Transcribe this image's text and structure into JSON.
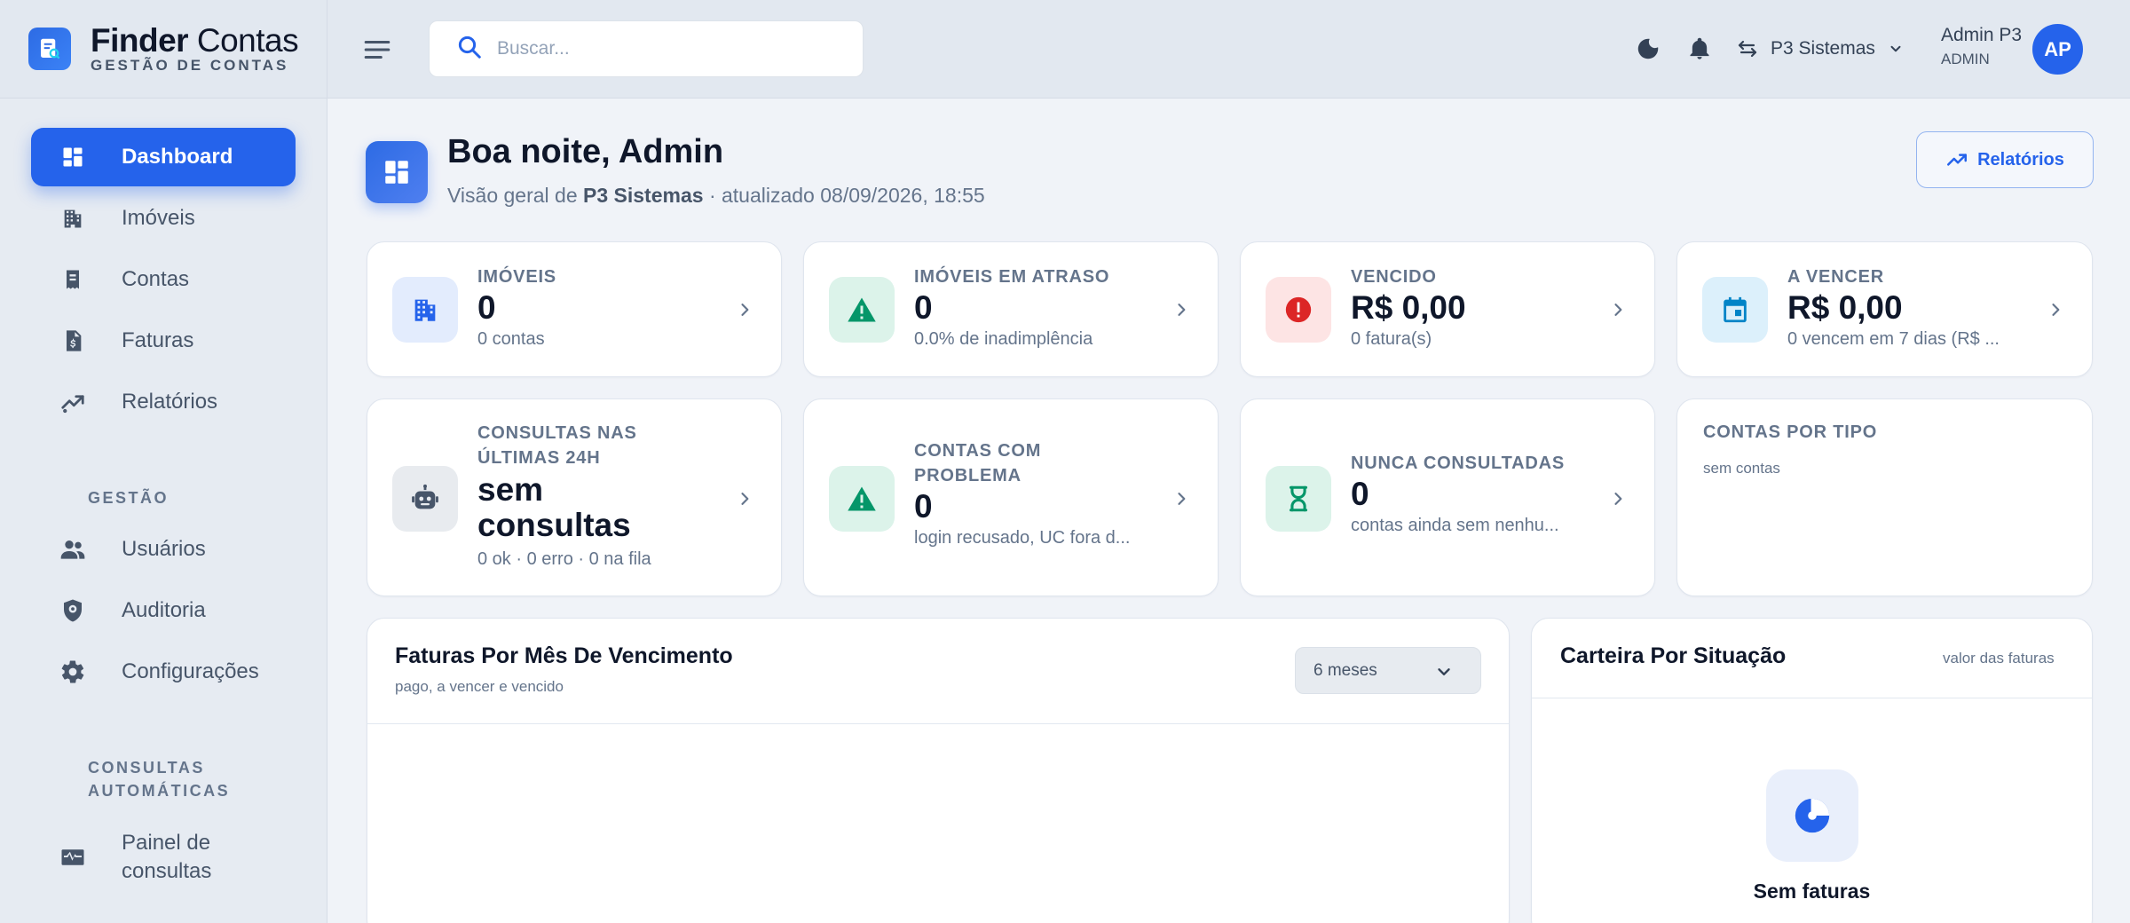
{
  "brand": {
    "name_bold": "Finder",
    "name_light": "Contas",
    "tagline": "GESTÃO DE CONTAS"
  },
  "sidebar": {
    "items": [
      {
        "label": "Dashboard",
        "icon": "dashboard-icon",
        "active": true
      },
      {
        "label": "Imóveis",
        "icon": "building-icon"
      },
      {
        "label": "Contas",
        "icon": "receipt-icon"
      },
      {
        "label": "Faturas",
        "icon": "invoice-icon"
      },
      {
        "label": "Relatórios",
        "icon": "trend-icon"
      }
    ],
    "section_gestao": "GESTÃO",
    "gestao_items": [
      {
        "label": "Usuários",
        "icon": "users-icon"
      },
      {
        "label": "Auditoria",
        "icon": "shield-icon"
      },
      {
        "label": "Configurações",
        "icon": "gear-icon"
      }
    ],
    "section_consultas": "CONSULTAS AUTOMÁTICAS",
    "consultas_items": [
      {
        "label": "Painel de consultas",
        "icon": "monitor-heart-icon"
      }
    ]
  },
  "topbar": {
    "search_placeholder": "Buscar...",
    "org": "P3 Sistemas",
    "user_name": "Admin P3",
    "user_role": "ADMIN",
    "avatar_initials": "AP"
  },
  "header": {
    "greeting": "Boa noite, Admin",
    "overview_prefix": "Visão geral de",
    "overview_org": "P3 Sistemas",
    "updated": "· atualizado 08/09/2026, 18:55",
    "reports_button": "Relatórios"
  },
  "stats": [
    {
      "label": "IMÓVEIS",
      "value": "0",
      "sub": "0 contas",
      "icon": "building-icon",
      "bg": "#e3ecfd",
      "color": "#2563eb"
    },
    {
      "label": "IMÓVEIS EM ATRASO",
      "value": "0",
      "sub": "0.0% de inadimplência",
      "icon": "warning-icon",
      "bg": "#dcf3ea",
      "color": "#059669"
    },
    {
      "label": "VENCIDO",
      "value": "R$ 0,00",
      "sub": "0 fatura(s)",
      "icon": "error-icon",
      "bg": "#fde4e4",
      "color": "#dc2626"
    },
    {
      "label": "A VENCER",
      "value": "R$ 0,00",
      "sub": "0 vencem em 7 dias (R$ ...",
      "icon": "calendar-icon",
      "bg": "#dcf0fb",
      "color": "#0284c7"
    },
    {
      "label_1": "CONSULTAS NAS",
      "label_2": "ÚLTIMAS 24H",
      "value_1": "sem",
      "value_2": "consultas",
      "sub": "0 ok · 0 erro · 0 na fila",
      "icon": "robot-icon",
      "bg": "#e8ebef",
      "color": "#475569"
    },
    {
      "label_1": "CONTAS COM",
      "label_2": "PROBLEMA",
      "value": "0",
      "sub": "login recusado, UC fora d...",
      "icon": "warning-icon",
      "bg": "#dcf3ea",
      "color": "#059669"
    },
    {
      "label": "NUNCA CONSULTADAS",
      "value": "0",
      "sub": "contas ainda sem nenhu...",
      "icon": "hourglass-icon",
      "bg": "#dcf3ea",
      "color": "#059669"
    },
    {
      "label": "CONTAS POR TIPO",
      "sub": "sem contas"
    }
  ],
  "panels": {
    "monthly": {
      "title": "Faturas Por Mês De Vencimento",
      "subtitle": "pago, a vencer e vencido",
      "range": "6 meses"
    },
    "portfolio": {
      "title": "Carteira Por Situação",
      "note": "valor das faturas",
      "empty": "Sem faturas"
    }
  },
  "colors": {
    "accent": "#2563eb",
    "sidebar_bg": "#e6ebf2",
    "page_bg": "#f0f3f8"
  }
}
